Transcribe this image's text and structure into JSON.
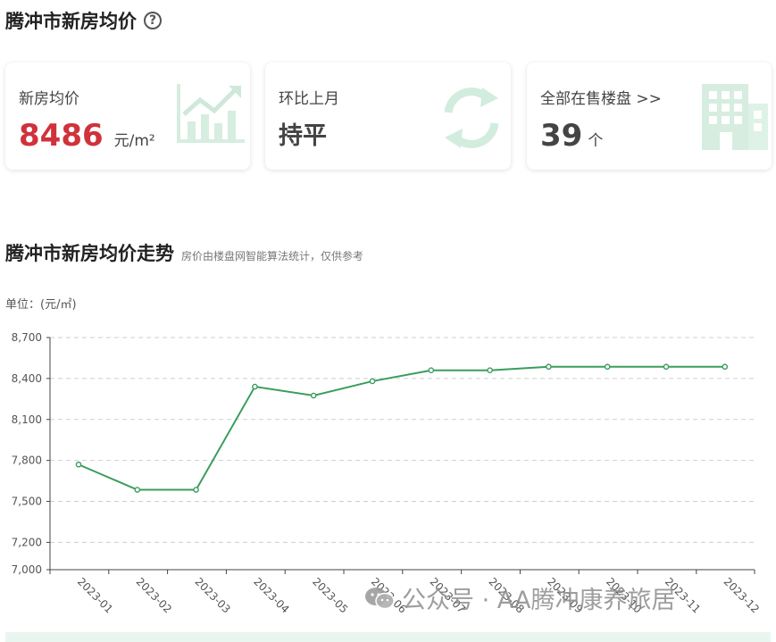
{
  "header": {
    "title": "腾冲市新房均价",
    "help_icon": "question-circle-icon"
  },
  "cards": [
    {
      "label": "新房均价",
      "value": "8486",
      "unit": "元/m²",
      "icon": "chart-up-icon"
    },
    {
      "label": "环比上月",
      "value": "持平",
      "icon": "refresh-icon"
    },
    {
      "label": "全部在售楼盘 >>",
      "value": "39",
      "unit": "个",
      "icon": "building-icon"
    }
  ],
  "section": {
    "title": "腾冲市新房均价走势",
    "note": "房价由楼盘网智能算法统计，仅供参考"
  },
  "chart_unit": "单位：(元/㎡)",
  "colors": {
    "accent_red": "#d0323b",
    "line_green": "#3a9d5d",
    "icon_green": "#cfe9da"
  },
  "chart_data": {
    "type": "line",
    "categories": [
      "2023-01",
      "2023-02",
      "2023-03",
      "2023-04",
      "2023-05",
      "2023-06",
      "2023-07",
      "2023-08",
      "2023-09",
      "2023-10",
      "2023-11",
      "2023-12"
    ],
    "series": [
      {
        "values": [
          7770,
          7585,
          7585,
          8340,
          8275,
          8380,
          8460,
          8460,
          8486,
          8486,
          8486,
          8486
        ]
      }
    ],
    "ylim": [
      7000,
      8700
    ],
    "yticks": [
      7000,
      7200,
      7500,
      7800,
      8100,
      8400,
      8700
    ],
    "ytick_labels": [
      "7,000",
      "7,200",
      "7,500",
      "7,800",
      "8,100",
      "8,400",
      "8,700"
    ],
    "grid": true,
    "title": "",
    "xlabel": "",
    "ylabel": ""
  },
  "watermark": {
    "text": "公众号 · AA腾冲康养旅居",
    "icon": "wechat-icon"
  }
}
